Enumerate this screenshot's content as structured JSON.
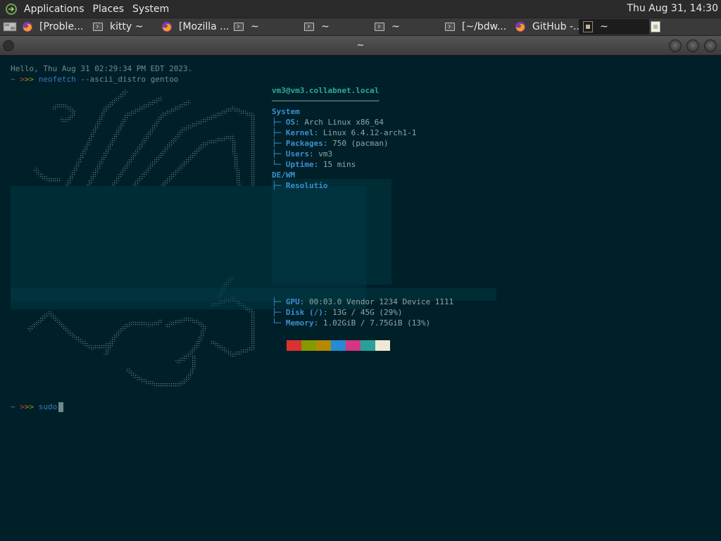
{
  "top_panel": {
    "menus": [
      "Applications",
      "Places",
      "System"
    ],
    "clock": "Thu Aug 31, 14:30"
  },
  "taskbar": {
    "tasks": [
      {
        "label": "[Proble...",
        "icon": "firefox-icon"
      },
      {
        "label": "kitty ~",
        "icon": "terminal-icon"
      },
      {
        "label": "[Mozilla ...",
        "icon": "firefox-icon"
      },
      {
        "label": "~",
        "icon": "terminal-icon"
      },
      {
        "label": "~",
        "icon": "terminal-icon"
      },
      {
        "label": "~",
        "icon": "terminal-icon"
      },
      {
        "label": "[~/bdw...",
        "icon": "terminal-icon"
      },
      {
        "label": "GitHub -...",
        "icon": "firefox-icon"
      },
      {
        "label": "~",
        "icon": "kitty-icon",
        "active": true
      }
    ]
  },
  "window": {
    "title": "~"
  },
  "terminal": {
    "greeting": "Hello, Thu Aug 31 02:29:34 PM EDT 2023.",
    "prompt_tilde": "~",
    "prompt_arrows": ">>>",
    "command": "neofetch",
    "command_args": "--ascii_distro gentoo",
    "final_command": "sudo",
    "info": {
      "user_host": "vm3@vm3.collabnet.local",
      "separator": "───────────────────────",
      "section_system": "System",
      "rows_system": [
        {
          "label": "OS",
          "value": "Arch Linux x86_64"
        },
        {
          "label": "Kernel",
          "value": "Linux 6.4.12-arch1-1"
        },
        {
          "label": "Packages",
          "value": "750 (pacman)"
        },
        {
          "label": "Users",
          "value": "vm3"
        },
        {
          "label": "Uptime",
          "value": "15 mins"
        }
      ],
      "section_dewm": "DE/WM",
      "resolution_label": "Resolutio",
      "rows_hw": [
        {
          "label": "GPU",
          "value": "00:03.0 Vendor 1234 Device 1111"
        },
        {
          "label": "Disk (/)",
          "value": "13G / 45G (29%)"
        },
        {
          "label": "Memory",
          "value": "1.02GiB / 7.75GiB (13%)"
        }
      ],
      "palette": [
        "#dc322f",
        "#859900",
        "#b58900",
        "#268bd2",
        "#d33682",
        "#2aa198",
        "#eee8d5"
      ]
    }
  }
}
